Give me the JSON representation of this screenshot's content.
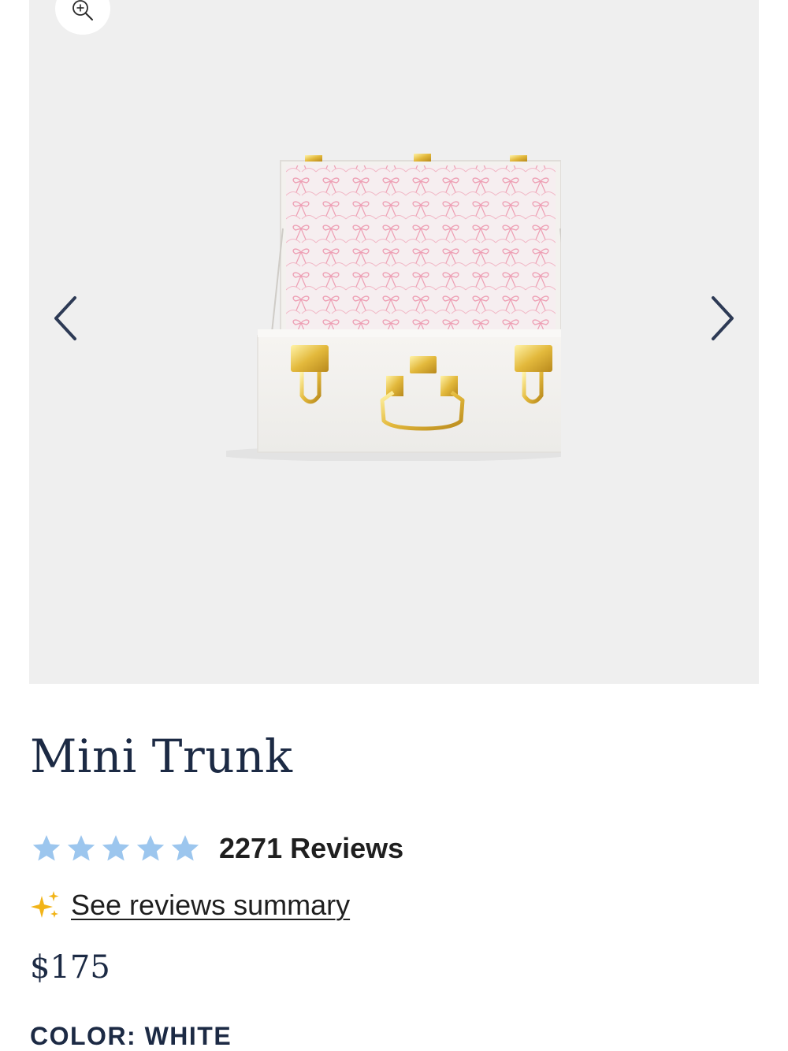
{
  "gallery": {
    "zoom_icon": "zoom-in-icon",
    "prev_icon": "chevron-left-icon",
    "next_icon": "chevron-right-icon",
    "background_color": "#efefef"
  },
  "product": {
    "title": "Mini Trunk",
    "rating": 5,
    "reviews_label": "2271 Reviews",
    "summary_icon": "sparkle-icon",
    "summary_link": "See reviews summary",
    "price": "$175",
    "color_label": "COLOR:",
    "color_value": "WHITE"
  },
  "colors": {
    "star": "#9cc6ee",
    "text": "#1c2a44",
    "sparkle": "#f2b418"
  }
}
